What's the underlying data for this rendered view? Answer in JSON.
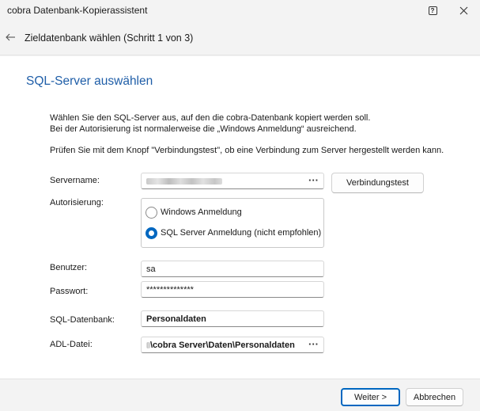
{
  "window": {
    "title": "cobra Datenbank-Kopierassistent"
  },
  "nav": {
    "title": "Zieldatenbank wählen (Schritt 1 von 3)"
  },
  "page": {
    "heading": "SQL-Server auswählen",
    "desc_line1": "Wählen Sie den SQL-Server aus, auf den die cobra-Datenbank kopiert werden soll.",
    "desc_line2": "Bei der Autorisierung ist normalerweise die „Windows Anmeldung“ ausreichend.",
    "desc_line3": "Prüfen Sie mit dem Knopf \"Verbindungstest\", ob eine Verbindung zum Server hergestellt werden kann."
  },
  "form": {
    "servername_label": "Servername:",
    "browse_dots": "···",
    "test_button": "Verbindungstest",
    "auth_label": "Autorisierung:",
    "auth_options": [
      {
        "label": "Windows Anmeldung",
        "checked": false
      },
      {
        "label": "SQL Server Anmeldung (nicht empfohlen)",
        "checked": true
      }
    ],
    "user_label": "Benutzer:",
    "user_value": "sa",
    "password_label": "Passwort:",
    "password_value": "**************",
    "sqldb_label": "SQL-Datenbank:",
    "sqldb_value": "Personaldaten",
    "adl_label": "ADL-Datei:",
    "adl_value": "\\cobra Server\\Daten\\Personaldaten"
  },
  "footer": {
    "next_button": "Weiter >",
    "cancel_button": "Abbrechen"
  },
  "colors": {
    "accent": "#0067c0",
    "heading": "#1f5ea8"
  }
}
